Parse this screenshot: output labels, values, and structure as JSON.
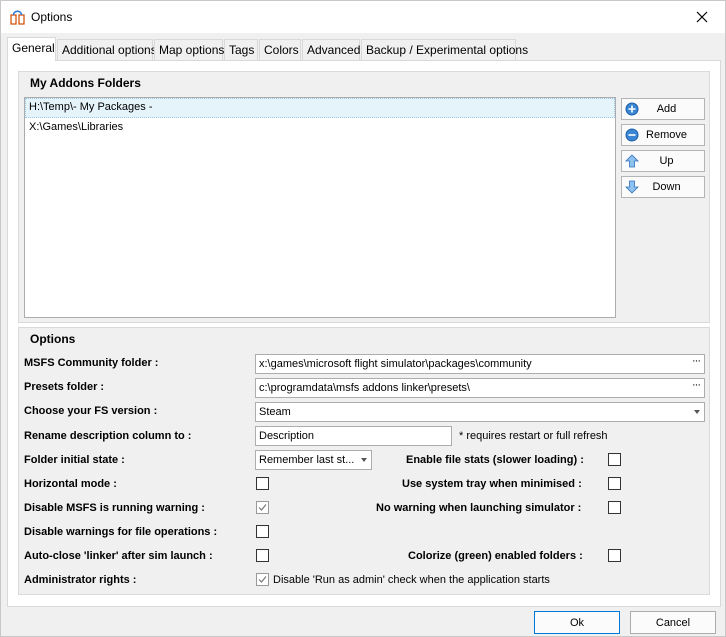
{
  "window": {
    "title": "Options",
    "icon": "app-icon",
    "close_icon": "close-icon"
  },
  "tabs": [
    {
      "label": "General",
      "active": true
    },
    {
      "label": "Additional options"
    },
    {
      "label": "Map options"
    },
    {
      "label": "Tags"
    },
    {
      "label": "Colors"
    },
    {
      "label": "Advanced"
    },
    {
      "label": "Backup / Experimental options"
    }
  ],
  "addons": {
    "header": "My Addons Folders",
    "folders": [
      "H:\\Temp\\- My Packages -",
      "X:\\Games\\Libraries"
    ],
    "selected_index": 0,
    "buttons": {
      "add": "Add",
      "remove": "Remove",
      "up": "Up",
      "down": "Down"
    }
  },
  "options": {
    "header": "Options",
    "community_folder": {
      "label": "MSFS Community folder :",
      "value": "x:\\games\\microsoft flight simulator\\packages\\community",
      "browse": "···"
    },
    "presets_folder": {
      "label": "Presets folder :",
      "value": "c:\\programdata\\msfs addons linker\\presets\\",
      "browse": "···"
    },
    "fs_version": {
      "label": "Choose your FS version :",
      "value": "Steam"
    },
    "rename_column": {
      "label": "Rename description column to :",
      "value": "Description",
      "note": "* requires restart or full refresh"
    },
    "folder_state": {
      "label": "Folder initial state :",
      "value": "Remember last st..."
    },
    "file_stats": {
      "label": "Enable file stats (slower loading) :",
      "checked": false
    },
    "horizontal_mode": {
      "label": "Horizontal mode :",
      "checked": false
    },
    "system_tray": {
      "label": "Use system tray when minimised :",
      "checked": false
    },
    "disable_running_warning": {
      "label": "Disable MSFS is running warning :",
      "checked": true
    },
    "no_launch_warning": {
      "label": "No warning when launching simulator :",
      "checked": false
    },
    "disable_file_warnings": {
      "label": "Disable warnings for file operations :",
      "checked": false
    },
    "auto_close": {
      "label": "Auto-close 'linker' after sim launch :",
      "checked": false
    },
    "colorize": {
      "label": "Colorize (green) enabled folders :",
      "checked": false
    },
    "admin_rights": {
      "label": "Administrator rights :",
      "checked": true,
      "text": "Disable 'Run as admin' check when the application starts"
    }
  },
  "dialog_buttons": {
    "ok": "Ok",
    "cancel": "Cancel"
  },
  "colors": {
    "accent": "#0078d7",
    "selection": "#e5f3fb"
  }
}
